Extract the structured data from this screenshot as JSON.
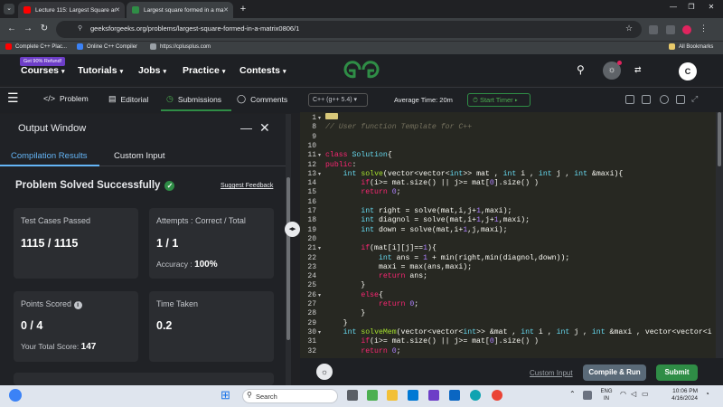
{
  "browser": {
    "tabs": [
      {
        "title": "Lecture 115: Largest Square ar",
        "favicon_color": "#ff0000"
      },
      {
        "title": "Largest square formed in a ma",
        "favicon_color": "#2f8d46"
      }
    ],
    "url": "geeksforgeeks.org/problems/largest-square-formed-in-a-matrix0806/1",
    "bookmarks": [
      {
        "label": "Complete C++ Plac...",
        "color": "#ff0000"
      },
      {
        "label": "Online C++ Compiler",
        "color": "#3b82f6"
      },
      {
        "label": "https://cplusplus.com",
        "color": "#9aa0a6"
      }
    ],
    "all_bookmarks": "All Bookmarks",
    "avatar_letter": "C"
  },
  "gfg": {
    "refund_badge": "Get 90% Refund!",
    "nav": [
      "Courses",
      "Tutorials",
      "Jobs",
      "Practice",
      "Contests"
    ],
    "logo": "GG",
    "user_letter": "C"
  },
  "subnav": {
    "tabs": [
      "Problem",
      "Editorial",
      "Submissions",
      "Comments"
    ],
    "active": "Submissions"
  },
  "output": {
    "title": "Output Window",
    "tabs": [
      "Compilation Results",
      "Custom Input"
    ],
    "status": "Problem Solved Successfully",
    "feedback": "Suggest Feedback",
    "cards": {
      "test_cases_label": "Test Cases Passed",
      "test_cases_value": "1115 / 1115",
      "attempts_label": "Attempts : Correct / Total",
      "attempts_value": "1 / 1",
      "accuracy_label": "Accuracy :",
      "accuracy_value": "100%",
      "points_label": "Points Scored",
      "points_value": "0 / 4",
      "total_label": "Your Total Score:",
      "total_value": "147",
      "time_label": "Time Taken",
      "time_value": "0.2"
    }
  },
  "editor": {
    "language": "C++ (g++ 5.4)",
    "avg_time": "Average Time: 20m",
    "timer": "Start Timer",
    "custom_input": "Custom Input",
    "compile_run": "Compile & Run",
    "submit": "Submit",
    "lines": [
      {
        "n": "1",
        "fold": true,
        "tokens": []
      },
      {
        "n": "8",
        "tokens": [
          [
            "cm",
            "// User function Template for C++"
          ]
        ]
      },
      {
        "n": "9",
        "tokens": []
      },
      {
        "n": "10",
        "tokens": []
      },
      {
        "n": "11",
        "fold": true,
        "tokens": [
          [
            "kw",
            "class"
          ],
          [
            "",
            " "
          ],
          [
            "ty",
            "Solution"
          ],
          [
            "",
            "{"
          ]
        ]
      },
      {
        "n": "12",
        "tokens": [
          [
            "kw",
            "public"
          ],
          [
            "",
            ":"
          ]
        ]
      },
      {
        "n": "13",
        "fold": true,
        "tokens": [
          [
            "",
            "    "
          ],
          [
            "ty",
            "int"
          ],
          [
            "",
            " "
          ],
          [
            "fn",
            "solve"
          ],
          [
            "",
            "(vector<vector<"
          ],
          [
            "ty",
            "int"
          ],
          [
            "",
            ">> mat , "
          ],
          [
            "ty",
            "int"
          ],
          [
            "",
            " i , "
          ],
          [
            "ty",
            "int"
          ],
          [
            "",
            " j , "
          ],
          [
            "ty",
            "int"
          ],
          [
            "",
            " &maxi){"
          ]
        ]
      },
      {
        "n": "14",
        "tokens": [
          [
            "",
            "        "
          ],
          [
            "kw",
            "if"
          ],
          [
            "",
            "(i>= mat.size() || j>= mat["
          ],
          [
            "nm",
            "0"
          ],
          [
            "",
            "].size() )"
          ]
        ]
      },
      {
        "n": "15",
        "tokens": [
          [
            "",
            "        "
          ],
          [
            "kw",
            "return"
          ],
          [
            "",
            " "
          ],
          [
            "nm",
            "0"
          ],
          [
            "",
            ";"
          ]
        ]
      },
      {
        "n": "16",
        "tokens": []
      },
      {
        "n": "17",
        "tokens": [
          [
            "",
            "        "
          ],
          [
            "ty",
            "int"
          ],
          [
            "",
            " right = solve(mat,i,j+"
          ],
          [
            "nm",
            "1"
          ],
          [
            "",
            ",maxi);"
          ]
        ]
      },
      {
        "n": "18",
        "tokens": [
          [
            "",
            "        "
          ],
          [
            "ty",
            "int"
          ],
          [
            "",
            " diagnol = solve(mat,i+"
          ],
          [
            "nm",
            "1"
          ],
          [
            "",
            ",j+"
          ],
          [
            "nm",
            "1"
          ],
          [
            "",
            ",maxi);"
          ]
        ]
      },
      {
        "n": "19",
        "tokens": [
          [
            "",
            "        "
          ],
          [
            "ty",
            "int"
          ],
          [
            "",
            " down = solve(mat,i+"
          ],
          [
            "nm",
            "1"
          ],
          [
            "",
            ",j,maxi);"
          ]
        ]
      },
      {
        "n": "20",
        "tokens": []
      },
      {
        "n": "21",
        "fold": true,
        "tokens": [
          [
            "",
            "        "
          ],
          [
            "kw",
            "if"
          ],
          [
            "",
            "(mat[i][j]=="
          ],
          [
            "nm",
            "1"
          ],
          [
            "",
            "){"
          ]
        ]
      },
      {
        "n": "22",
        "tokens": [
          [
            "",
            "            "
          ],
          [
            "ty",
            "int"
          ],
          [
            "",
            " ans = "
          ],
          [
            "nm",
            "1"
          ],
          [
            "",
            " + min(right,min(diagnol,down));"
          ]
        ]
      },
      {
        "n": "23",
        "tokens": [
          [
            "",
            "            maxi = max(ans,maxi);"
          ]
        ]
      },
      {
        "n": "24",
        "tokens": [
          [
            "",
            "            "
          ],
          [
            "kw",
            "return"
          ],
          [
            "",
            " ans;"
          ]
        ]
      },
      {
        "n": "25",
        "tokens": [
          [
            "",
            "        }"
          ]
        ]
      },
      {
        "n": "26",
        "fold": true,
        "tokens": [
          [
            "",
            "        "
          ],
          [
            "kw",
            "else"
          ],
          [
            "",
            "{"
          ]
        ]
      },
      {
        "n": "27",
        "tokens": [
          [
            "",
            "            "
          ],
          [
            "kw",
            "return"
          ],
          [
            "",
            " "
          ],
          [
            "nm",
            "0"
          ],
          [
            "",
            ";"
          ]
        ]
      },
      {
        "n": "28",
        "tokens": [
          [
            "",
            "        }"
          ]
        ]
      },
      {
        "n": "29",
        "tokens": [
          [
            "",
            "    }"
          ]
        ]
      },
      {
        "n": "30",
        "fold": true,
        "tokens": [
          [
            "",
            "    "
          ],
          [
            "ty",
            "int"
          ],
          [
            "",
            " "
          ],
          [
            "fn",
            "solveMem"
          ],
          [
            "",
            "(vector<vector<"
          ],
          [
            "ty",
            "int"
          ],
          [
            "",
            ">> &mat , "
          ],
          [
            "ty",
            "int"
          ],
          [
            "",
            " i , "
          ],
          [
            "ty",
            "int"
          ],
          [
            "",
            " j , "
          ],
          [
            "ty",
            "int"
          ],
          [
            "",
            " &maxi , vector<vector<i"
          ]
        ]
      },
      {
        "n": "31",
        "tokens": [
          [
            "",
            "        "
          ],
          [
            "kw",
            "if"
          ],
          [
            "",
            "(i>= mat.size() || j>= mat["
          ],
          [
            "nm",
            "0"
          ],
          [
            "",
            "].size() )"
          ]
        ]
      },
      {
        "n": "32",
        "tokens": [
          [
            "",
            "        "
          ],
          [
            "kw",
            "return"
          ],
          [
            "",
            " "
          ],
          [
            "nm",
            "0"
          ],
          [
            "",
            ";"
          ]
        ]
      }
    ]
  },
  "taskbar": {
    "search": "Search",
    "lang_top": "ENG",
    "lang_bottom": "IN",
    "time": "10:06 PM",
    "date": "4/16/2024"
  }
}
